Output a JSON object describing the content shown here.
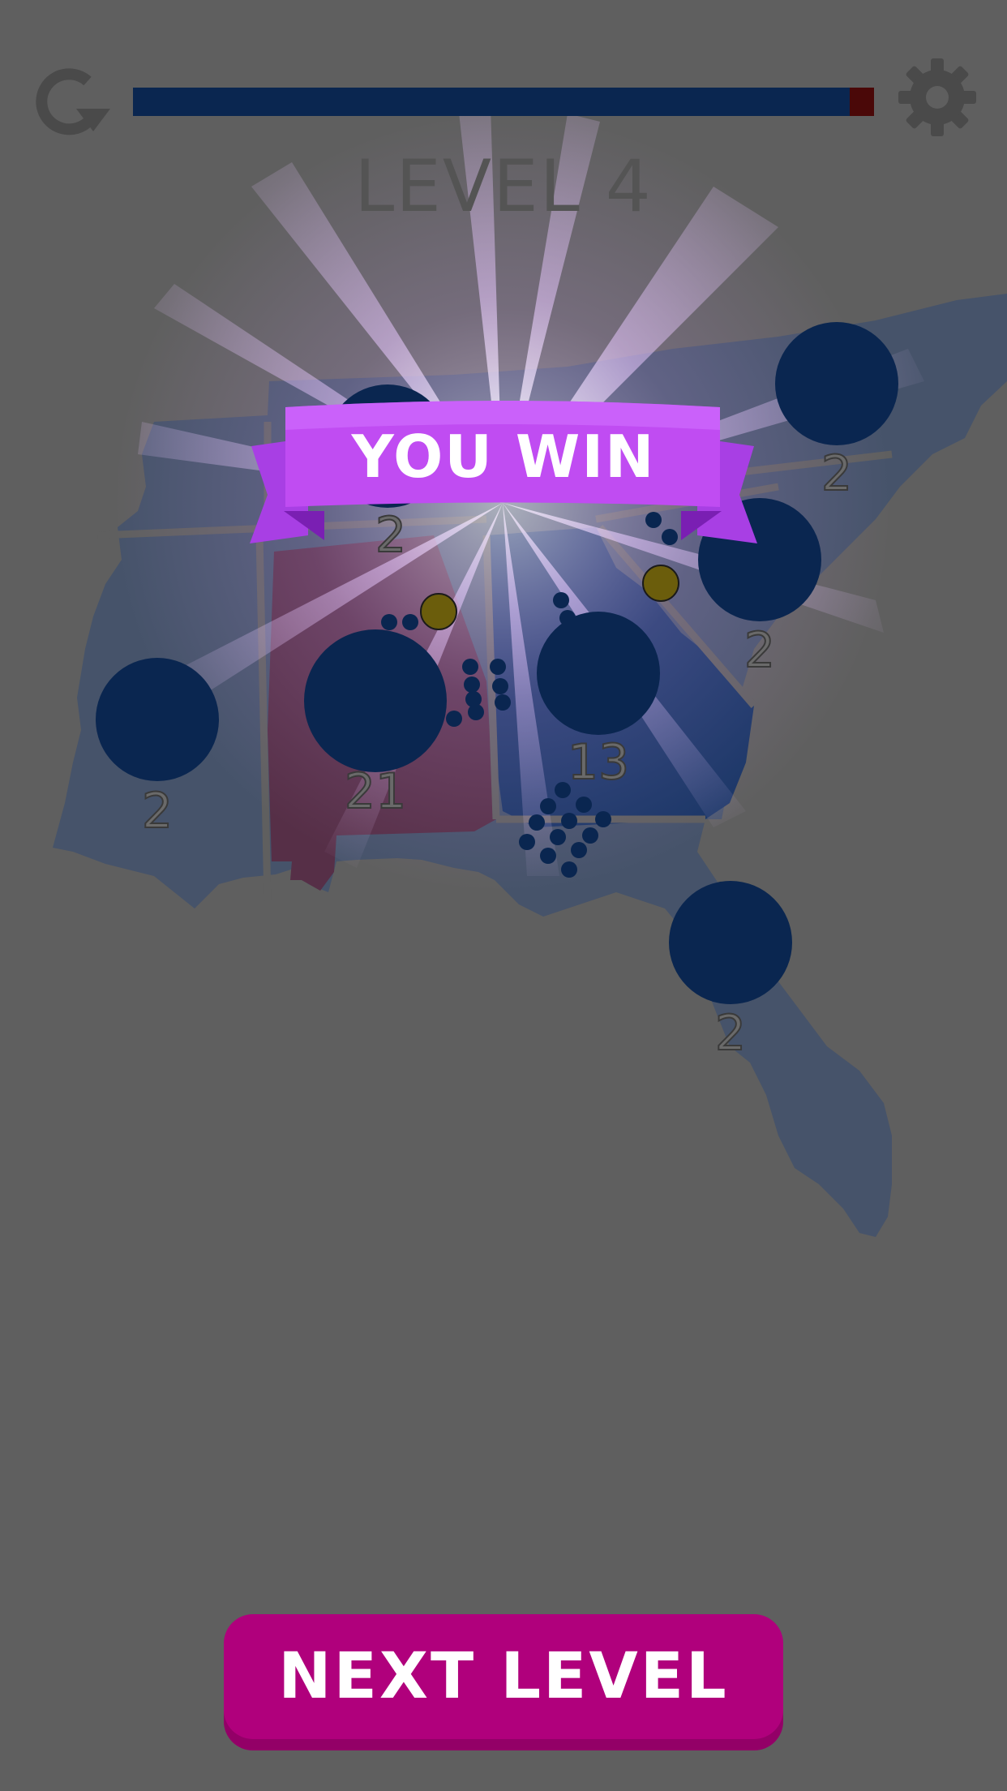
{
  "hud": {
    "restart_icon": "restart-icon",
    "settings_icon": "gear-icon",
    "progress": 0.96
  },
  "level_title": "LEVEL 4",
  "banner": {
    "text": "YOU WIN"
  },
  "territories": [
    {
      "name": "mississippi",
      "count": "2"
    },
    {
      "name": "alabama",
      "count": "21"
    },
    {
      "name": "georgia",
      "count": "13"
    },
    {
      "name": "tennessee",
      "count": "2"
    },
    {
      "name": "north-carolina",
      "count": "2"
    },
    {
      "name": "south-carolina",
      "count": "2"
    },
    {
      "name": "florida",
      "count": "2"
    }
  ],
  "colors": {
    "background": "#5f5f5f",
    "map": "#46536a",
    "player": "#0a2650",
    "enemy": "#4a0808",
    "alabama_fill": "#562f47",
    "neutral_unit": "#6b5d0c",
    "banner": "#c04cf2",
    "button": "#b0007c"
  },
  "next_button": {
    "label": "NEXT LEVEL"
  }
}
